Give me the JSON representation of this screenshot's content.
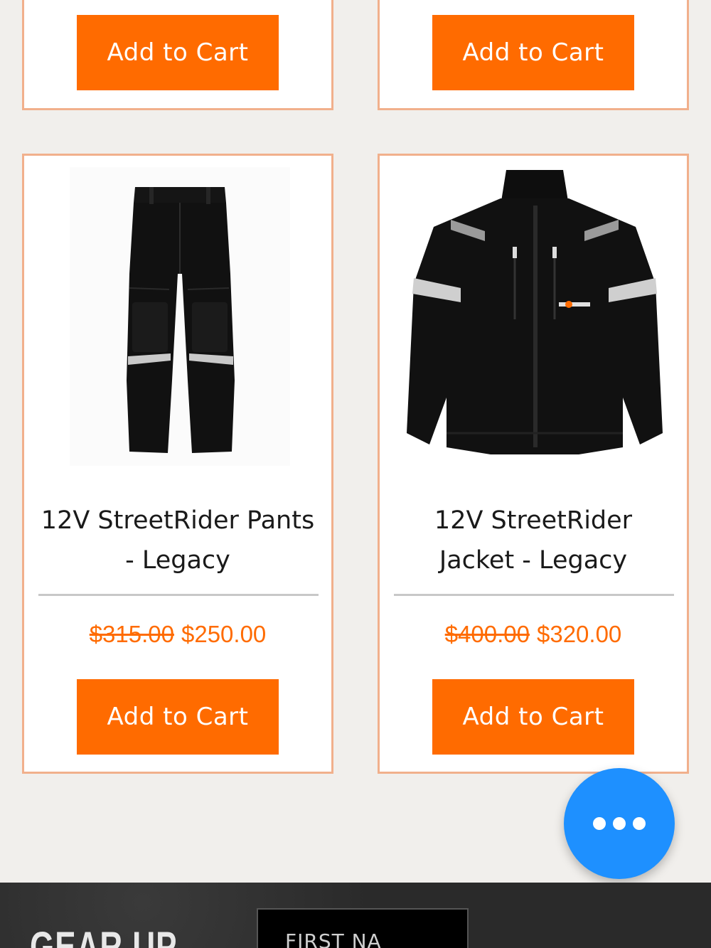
{
  "products_top": [
    {
      "button_label": "Add to Cart"
    },
    {
      "button_label": "Add to Cart"
    }
  ],
  "products": [
    {
      "title_line1": "12V StreetRider Pants",
      "title_line2": "- Legacy",
      "image_icon": "pants-image",
      "old_price": "$315.00",
      "price": "$250.00",
      "button_label": "Add to Cart"
    },
    {
      "title_line1": "12V StreetRider",
      "title_line2": "Jacket - Legacy",
      "image_icon": "jacket-image",
      "old_price": "$400.00",
      "price": "$320.00",
      "button_label": "Add to Cart"
    }
  ],
  "chat": {
    "icon": "more-dots-icon"
  },
  "footer": {
    "title": "GEAR UP",
    "first_name_placeholder": "FIRST NA"
  },
  "colors": {
    "accent": "#ff6b00",
    "card_border": "#f1b08c",
    "chat_button": "#1e90ff",
    "background": "#f1efec"
  }
}
